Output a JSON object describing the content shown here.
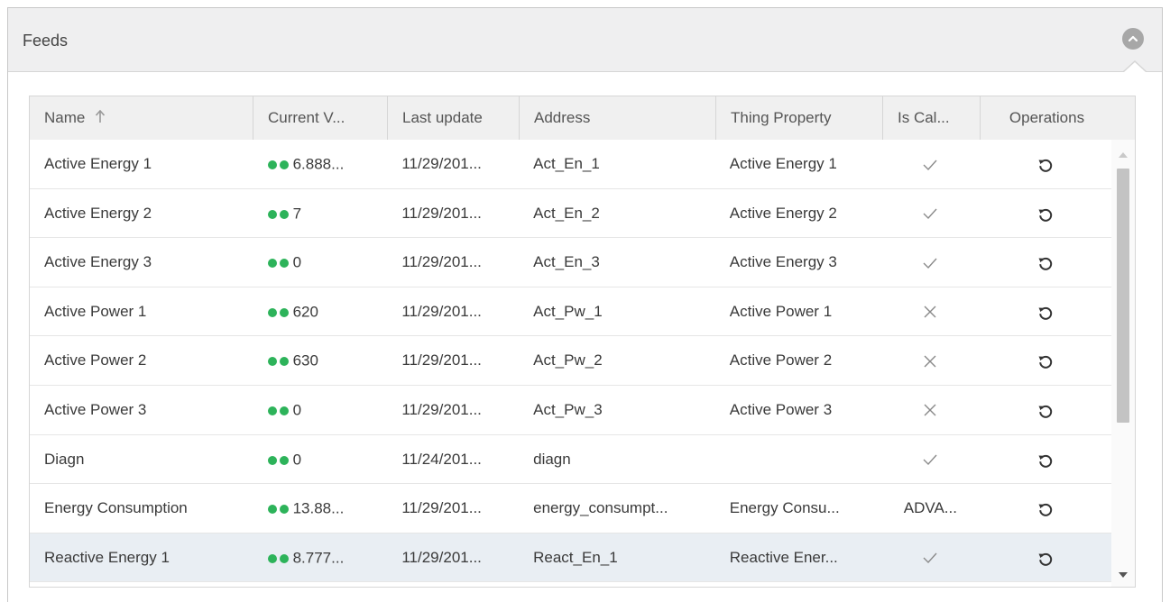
{
  "panel": {
    "title": "Feeds",
    "collapse_icon": "chevron-up-circle-icon"
  },
  "table": {
    "columns": [
      {
        "key": "name",
        "label": "Name",
        "sorted": "ascending"
      },
      {
        "key": "current_value",
        "label": "Current V..."
      },
      {
        "key": "last_update",
        "label": "Last update"
      },
      {
        "key": "address",
        "label": "Address"
      },
      {
        "key": "thing_property",
        "label": "Thing Property"
      },
      {
        "key": "is_calculated",
        "label": "Is Cal..."
      },
      {
        "key": "operations",
        "label": "Operations"
      }
    ],
    "rows": [
      {
        "name": "Active Energy 1",
        "current_value": "6.888...",
        "last_update": "11/29/201...",
        "address": "Act_En_1",
        "thing_property": "Active Energy 1",
        "is_calculated": "check",
        "is_calculated_text": ""
      },
      {
        "name": "Active Energy 2",
        "current_value": "7",
        "last_update": "11/29/201...",
        "address": "Act_En_2",
        "thing_property": "Active Energy 2",
        "is_calculated": "check",
        "is_calculated_text": ""
      },
      {
        "name": "Active Energy 3",
        "current_value": "0",
        "last_update": "11/29/201...",
        "address": "Act_En_3",
        "thing_property": "Active Energy 3",
        "is_calculated": "check",
        "is_calculated_text": ""
      },
      {
        "name": "Active Power 1",
        "current_value": "620",
        "last_update": "11/29/201...",
        "address": "Act_Pw_1",
        "thing_property": "Active Power 1",
        "is_calculated": "cross",
        "is_calculated_text": ""
      },
      {
        "name": "Active Power 2",
        "current_value": "630",
        "last_update": "11/29/201...",
        "address": "Act_Pw_2",
        "thing_property": "Active Power 2",
        "is_calculated": "cross",
        "is_calculated_text": ""
      },
      {
        "name": "Active Power 3",
        "current_value": "0",
        "last_update": "11/29/201...",
        "address": "Act_Pw_3",
        "thing_property": "Active Power 3",
        "is_calculated": "cross",
        "is_calculated_text": ""
      },
      {
        "name": "Diagn",
        "current_value": "0",
        "last_update": "11/24/201...",
        "address": "diagn",
        "thing_property": "",
        "is_calculated": "check",
        "is_calculated_text": ""
      },
      {
        "name": "Energy Consumption",
        "current_value": "13.88...",
        "last_update": "11/29/201...",
        "address": "energy_consumpt...",
        "thing_property": "Energy Consu...",
        "is_calculated": "text",
        "is_calculated_text": "ADVA..."
      },
      {
        "name": "Reactive Energy 1",
        "current_value": "8.777...",
        "last_update": "11/29/201...",
        "address": "React_En_1",
        "thing_property": "Reactive Ener...",
        "is_calculated": "check",
        "is_calculated_text": "",
        "selected": true
      }
    ],
    "status_color": "#2db35a",
    "operation_icon": "reset-icon"
  }
}
